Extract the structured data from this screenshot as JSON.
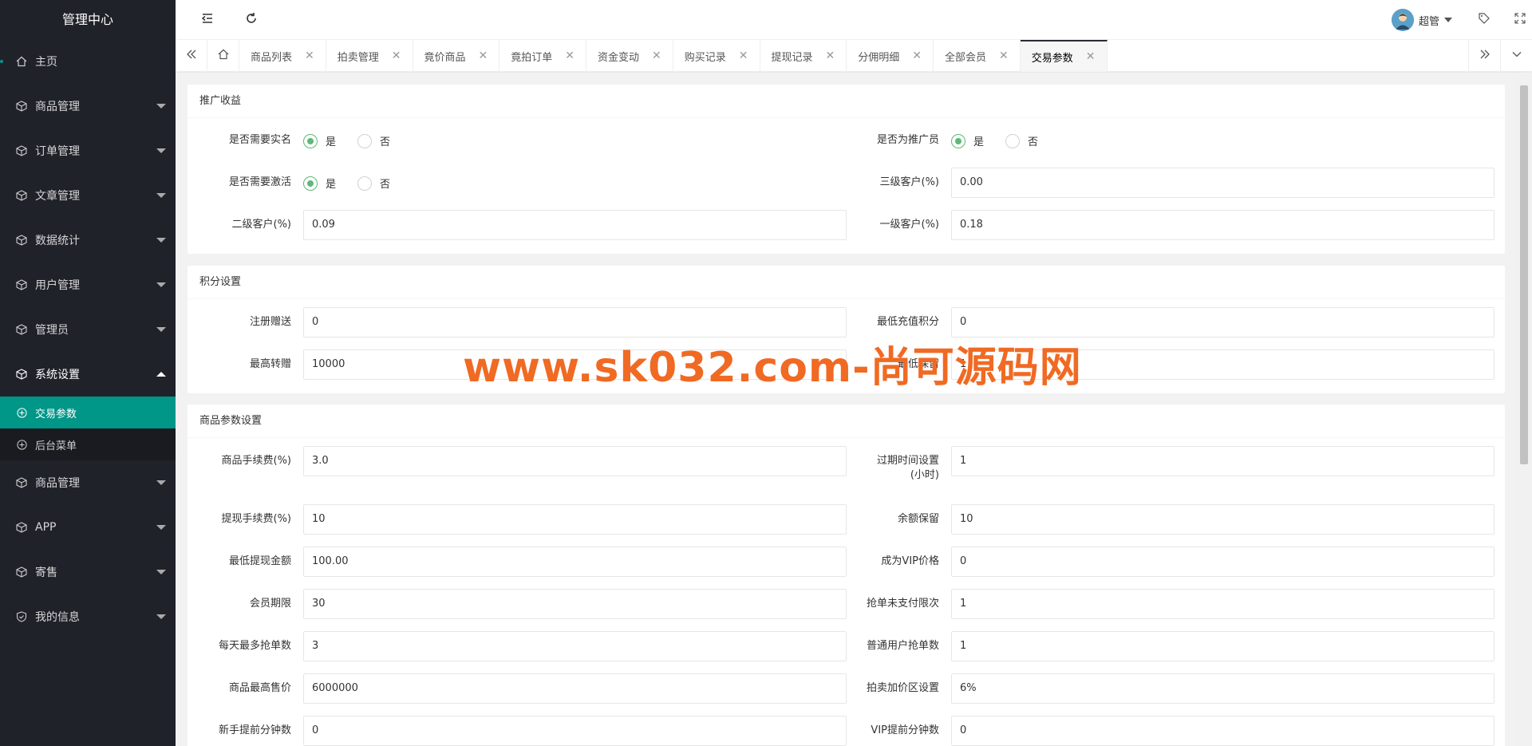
{
  "sidebar": {
    "title": "管理中心",
    "items": [
      {
        "label": "主页",
        "icon": "home-icon"
      },
      {
        "label": "商品管理",
        "icon": "cube-icon"
      },
      {
        "label": "订单管理",
        "icon": "cube-icon"
      },
      {
        "label": "文章管理",
        "icon": "cube-icon"
      },
      {
        "label": "数据统计",
        "icon": "cube-icon"
      },
      {
        "label": "用户管理",
        "icon": "cube-icon"
      },
      {
        "label": "管理员",
        "icon": "cube-icon"
      },
      {
        "label": "系统设置",
        "icon": "cube-icon"
      },
      {
        "label": "商品管理",
        "icon": "cube-icon"
      },
      {
        "label": "APP",
        "icon": "cube-icon"
      },
      {
        "label": "寄售",
        "icon": "cube-icon"
      },
      {
        "label": "我的信息",
        "icon": "shield-icon"
      }
    ],
    "sub_items": [
      {
        "label": "交易参数",
        "active": true
      },
      {
        "label": "后台菜单",
        "active": false
      }
    ],
    "accent_color": "#009688"
  },
  "header": {
    "user_name": "超管"
  },
  "tabs": [
    {
      "label": "商品列表"
    },
    {
      "label": "拍卖管理"
    },
    {
      "label": "竟价商品"
    },
    {
      "label": "竟拍订单"
    },
    {
      "label": "资金变动"
    },
    {
      "label": "购买记录"
    },
    {
      "label": "提现记录"
    },
    {
      "label": "分佣明细"
    },
    {
      "label": "全部会员"
    },
    {
      "label": "交易参数",
      "active": true
    }
  ],
  "sections": {
    "promo": {
      "title": "推广收益",
      "need_realname_label": "是否需要实名",
      "need_activate_label": "是否需要激活",
      "is_promoter_label": "是否为推广员",
      "yes": "是",
      "no": "否",
      "level3_label": "三级客户(%)",
      "level3_value": "0.00",
      "level2_label": "二级客户(%)",
      "level2_value": "0.09",
      "level1_label": "一级客户(%)",
      "level1_value": "0.18"
    },
    "points": {
      "title": "积分设置",
      "register_label": "注册赠送",
      "register_value": "0",
      "min_recharge_label": "最低充值积分",
      "min_recharge_value": "0",
      "max_transfer_label": "最高转赠",
      "max_transfer_value": "10000",
      "min_keep_label": "最低保留",
      "min_keep_value": "1"
    },
    "goods": {
      "title": "商品参数设置",
      "rows": [
        {
          "l_label": "商品手续费(%)",
          "l_value": "3.0",
          "r_label": "过期时间设置(小时)",
          "r_value": "1"
        },
        {
          "l_label": "提现手续费(%)",
          "l_value": "10",
          "r_label": "余额保留",
          "r_value": "10"
        },
        {
          "l_label": "最低提现金额",
          "l_value": "100.00",
          "r_label": "成为VIP价格",
          "r_value": "0"
        },
        {
          "l_label": "会员期限",
          "l_value": "30",
          "r_label": "抢单未支付限次",
          "r_value": "1"
        },
        {
          "l_label": "每天最多抢单数",
          "l_value": "3",
          "r_label": "普通用户抢单数",
          "r_value": "1"
        },
        {
          "l_label": "商品最高售价",
          "l_value": "6000000",
          "r_label": "拍卖加价区设置",
          "r_value": "6%"
        },
        {
          "l_label": "新手提前分钟数",
          "l_value": "0",
          "r_label": "VIP提前分钟数",
          "r_value": "0"
        }
      ]
    }
  },
  "watermark": "www.sk032.com-尚可源码网"
}
